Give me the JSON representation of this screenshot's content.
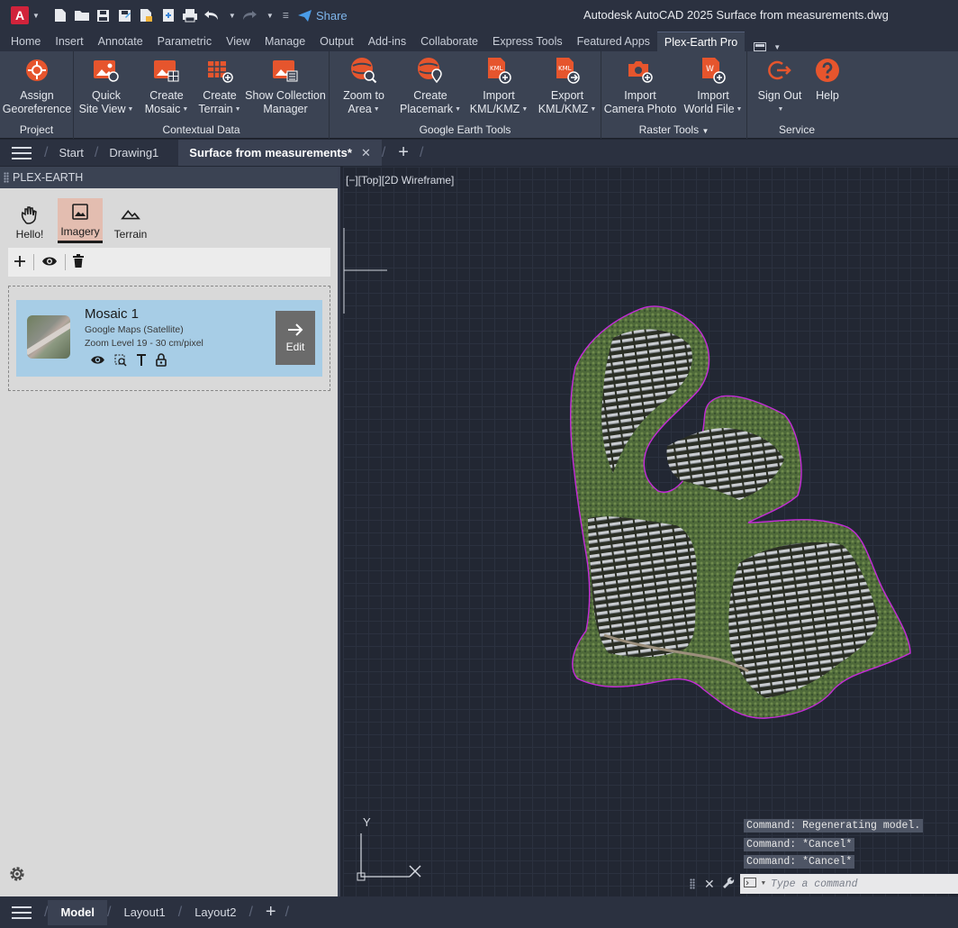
{
  "titlebar": {
    "logo": "A",
    "share": "Share",
    "title": "Autodesk AutoCAD 2025    Surface from measurements.dwg"
  },
  "ribbon_tabs": [
    "Home",
    "Insert",
    "Annotate",
    "Parametric",
    "View",
    "Manage",
    "Output",
    "Add-ins",
    "Collaborate",
    "Express Tools",
    "Featured Apps",
    "Plex-Earth Pro"
  ],
  "active_ribbon_tab": "Plex-Earth Pro",
  "ribbon": {
    "groups": {
      "project": "Project",
      "contextual": "Contextual Data",
      "google_earth": "Google Earth Tools",
      "raster": "Raster Tools",
      "service": "Service"
    },
    "buttons": {
      "assign": [
        "Assign",
        "Georeference"
      ],
      "quick_site": [
        "Quick",
        "Site View"
      ],
      "create_mosaic": [
        "Create",
        "Mosaic"
      ],
      "create_terrain": [
        "Create",
        "Terrain"
      ],
      "show_collection": [
        "Show Collection",
        "Manager"
      ],
      "zoom_area": [
        "Zoom to",
        "Area"
      ],
      "create_placemark": [
        "Create",
        "Placemark"
      ],
      "import_kml": [
        "Import",
        "KML/KMZ"
      ],
      "export_kml": [
        "Export",
        "KML/KMZ"
      ],
      "import_camera": [
        "Import",
        "Camera Photo"
      ],
      "import_world": [
        "Import",
        "World File"
      ],
      "sign_out": [
        "Sign Out",
        ""
      ],
      "help": [
        "Help",
        ""
      ]
    },
    "kml_icon_text": "KML",
    "world_icon_text": "W"
  },
  "file_tabs": {
    "start": "Start",
    "drawing1": "Drawing1",
    "active": "Surface from measurements*"
  },
  "palette": {
    "header": "PLEX-EARTH",
    "tabs": [
      "Hello!",
      "Imagery",
      "Terrain"
    ],
    "active_tab": "Imagery",
    "mosaic": {
      "title": "Mosaic 1",
      "source": "Google Maps (Satellite)",
      "zoom": "Zoom Level 19 - 30 cm/pixel",
      "edit": "Edit"
    }
  },
  "viewport": {
    "label": "[−][Top][2D Wireframe]",
    "ucs_y": "Y",
    "command_history": [
      "Command: Regenerating model.",
      "Command: *Cancel*",
      "Command: *Cancel*"
    ],
    "command_placeholder": "Type a command"
  },
  "layout_tabs": [
    "Model",
    "Layout1",
    "Layout2"
  ],
  "active_layout": "Model",
  "colors": {
    "accent_orange": "#e6552d",
    "boundary": "#c42ad8",
    "selected_card": "#a7cde6",
    "active_palette_tab": "#e3bdb0"
  }
}
